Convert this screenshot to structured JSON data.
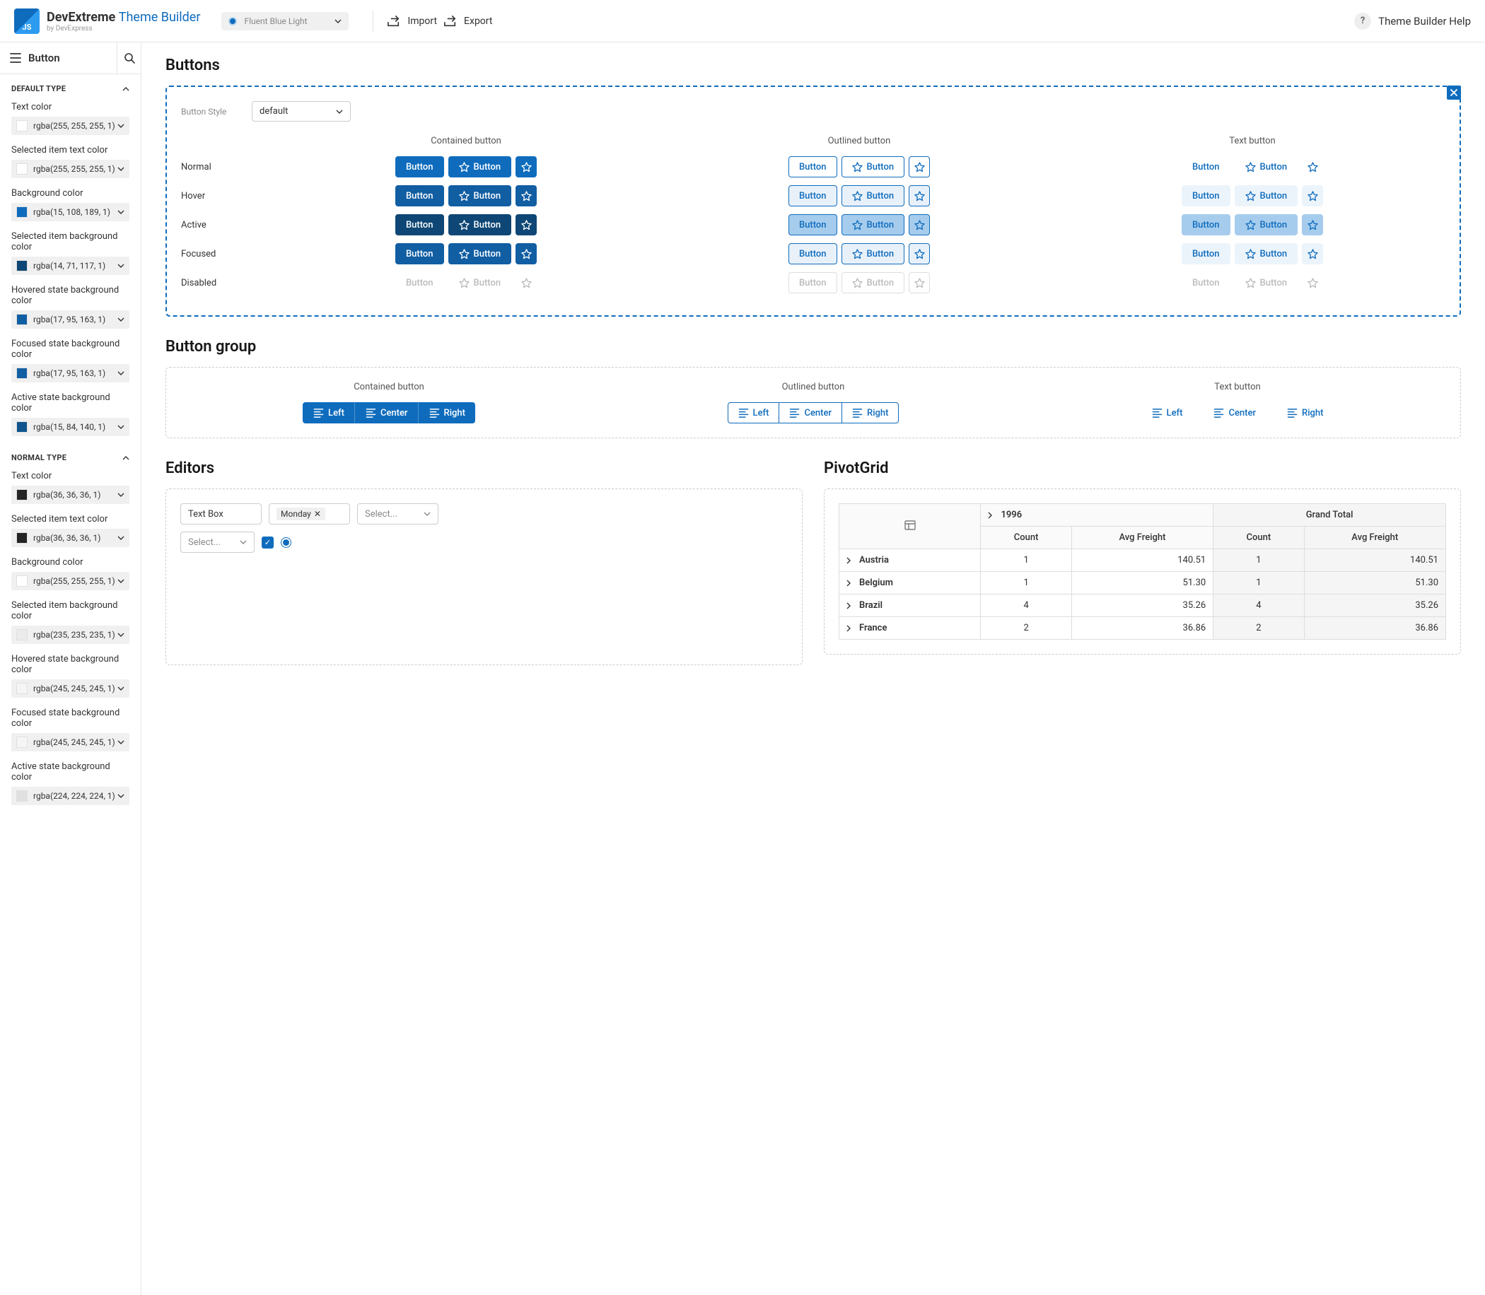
{
  "header": {
    "logo_badge": "JS",
    "brand1": "DevExtreme",
    "brand2": "Theme Builder",
    "brand_sub": "by DevExpress",
    "theme_name": "Fluent Blue Light",
    "import": "Import",
    "export": "Export",
    "help": "Theme Builder Help",
    "help_q": "?"
  },
  "sidebar": {
    "title": "Button",
    "groups": [
      {
        "title": "DEFAULT TYPE",
        "props": [
          {
            "label": "Text color",
            "value": "rgba(255, 255, 255, 1)",
            "swatch": "#ffffff"
          },
          {
            "label": "Selected item text color",
            "value": "rgba(255, 255, 255, 1)",
            "swatch": "#ffffff"
          },
          {
            "label": "Background color",
            "value": "rgba(15, 108, 189, 1)",
            "swatch": "#0f6cbd"
          },
          {
            "label": "Selected item background color",
            "value": "rgba(14, 71, 117, 1)",
            "swatch": "#0e4775"
          },
          {
            "label": "Hovered state background color",
            "value": "rgba(17, 95, 163, 1)",
            "swatch": "#115fa3"
          },
          {
            "label": "Focused state background color",
            "value": "rgba(17, 95, 163, 1)",
            "swatch": "#115fa3"
          },
          {
            "label": "Active state background color",
            "value": "rgba(15, 84, 140, 1)",
            "swatch": "#0f548c"
          }
        ]
      },
      {
        "title": "NORMAL TYPE",
        "props": [
          {
            "label": "Text color",
            "value": "rgba(36, 36, 36, 1)",
            "swatch": "#242424"
          },
          {
            "label": "Selected item text color",
            "value": "rgba(36, 36, 36, 1)",
            "swatch": "#242424"
          },
          {
            "label": "Background color",
            "value": "rgba(255, 255, 255, 1)",
            "swatch": "#ffffff"
          },
          {
            "label": "Selected item background color",
            "value": "rgba(235, 235, 235, 1)",
            "swatch": "#ebebeb"
          },
          {
            "label": "Hovered state background color",
            "value": "rgba(245, 245, 245, 1)",
            "swatch": "#f5f5f5"
          },
          {
            "label": "Focused state background color",
            "value": "rgba(245, 245, 245, 1)",
            "swatch": "#f5f5f5"
          },
          {
            "label": "Active state background color",
            "value": "rgba(224, 224, 224, 1)",
            "swatch": "#e0e0e0"
          }
        ]
      }
    ]
  },
  "sections": {
    "buttons": {
      "title": "Buttons",
      "style_label": "Button Style",
      "style_value": "default",
      "cols": [
        "Contained button",
        "Outlined button",
        "Text button"
      ],
      "states": [
        "Normal",
        "Hover",
        "Active",
        "Focused",
        "Disabled"
      ],
      "btn_text": "Button"
    },
    "button_group": {
      "title": "Button group",
      "cols": [
        "Contained button",
        "Outlined button",
        "Text button"
      ],
      "items": [
        "Left",
        "Center",
        "Right"
      ]
    },
    "editors": {
      "title": "Editors",
      "text_box": "Text Box",
      "tag": "Monday",
      "select_placeholder": "Select..."
    },
    "pivot": {
      "title": "PivotGrid",
      "year": "1996",
      "grand_total": "Grand Total",
      "count": "Count",
      "avg": "Avg Freight",
      "rows": [
        {
          "country": "Austria",
          "count": "1",
          "avg": "140.51",
          "gcount": "1",
          "gavg": "140.51"
        },
        {
          "country": "Belgium",
          "count": "1",
          "avg": "51.30",
          "gcount": "1",
          "gavg": "51.30"
        },
        {
          "country": "Brazil",
          "count": "4",
          "avg": "35.26",
          "gcount": "4",
          "gavg": "35.26"
        },
        {
          "country": "France",
          "count": "2",
          "avg": "36.86",
          "gcount": "2",
          "gavg": "36.86"
        }
      ]
    }
  }
}
